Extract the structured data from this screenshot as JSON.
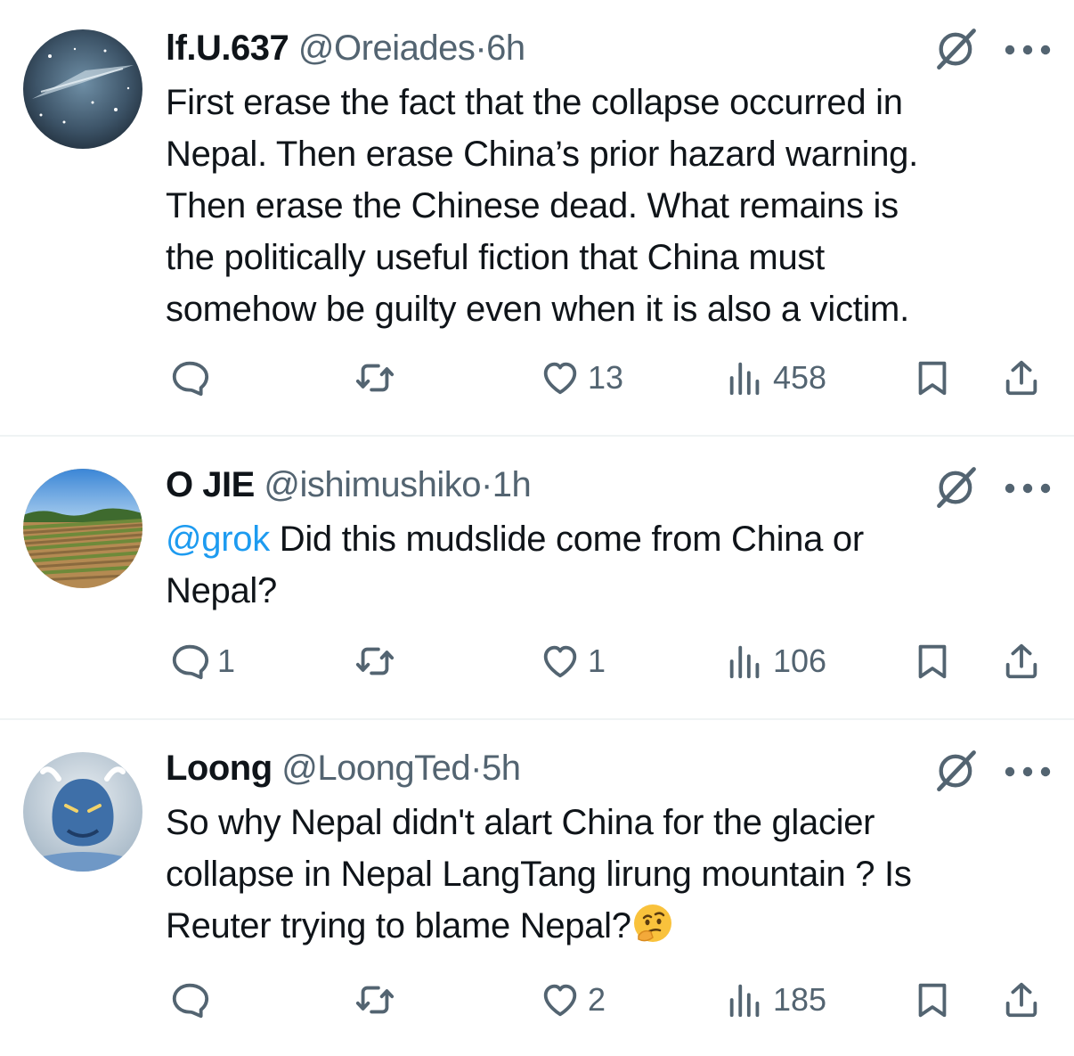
{
  "tweets": [
    {
      "name": "lf.U.637",
      "handle": "@Oreiades",
      "sep": "·",
      "time": "6h",
      "text_lines": [
        "First erase the fact that the collapse occurred in",
        "Nepal. Then erase China’s prior hazard warning.",
        "Then erase the Chinese dead. What remains is",
        "the politically useful fiction that China must",
        "somehow be guilty even when it is also a victim."
      ],
      "replies": "",
      "reposts": "",
      "likes": "13",
      "views": "458"
    },
    {
      "name": "O JIE",
      "handle": "@ishimushiko",
      "sep": "·",
      "time": "1h",
      "mention": "@grok",
      "text_line1": " Did this mudslide come from China or",
      "text_line2": "Nepal?",
      "replies": "1",
      "reposts": "",
      "likes": "1",
      "views": "106"
    },
    {
      "name": "Loong",
      "handle": "@LoongTed",
      "sep": "·",
      "time": "5h",
      "text_lines": [
        "So why Nepal didn't alart China for the glacier",
        "collapse in Nepal LangTang lirung mountain ? Is"
      ],
      "text_line3": "Reuter trying to blame Nepal?",
      "emoji": "thinking-face",
      "replies": "",
      "reposts": "",
      "likes": "2",
      "views": "185"
    }
  ],
  "icons": {
    "reply": "reply-icon",
    "repost": "repost-icon",
    "like": "like-icon",
    "views": "views-icon",
    "bookmark": "bookmark-icon",
    "share": "share-icon",
    "grok": "grok-icon",
    "more": "more-icon"
  },
  "colors": {
    "text": "#0f1419",
    "secondary": "#536471",
    "link": "#1d9bf0",
    "divider": "#eff3f4"
  }
}
